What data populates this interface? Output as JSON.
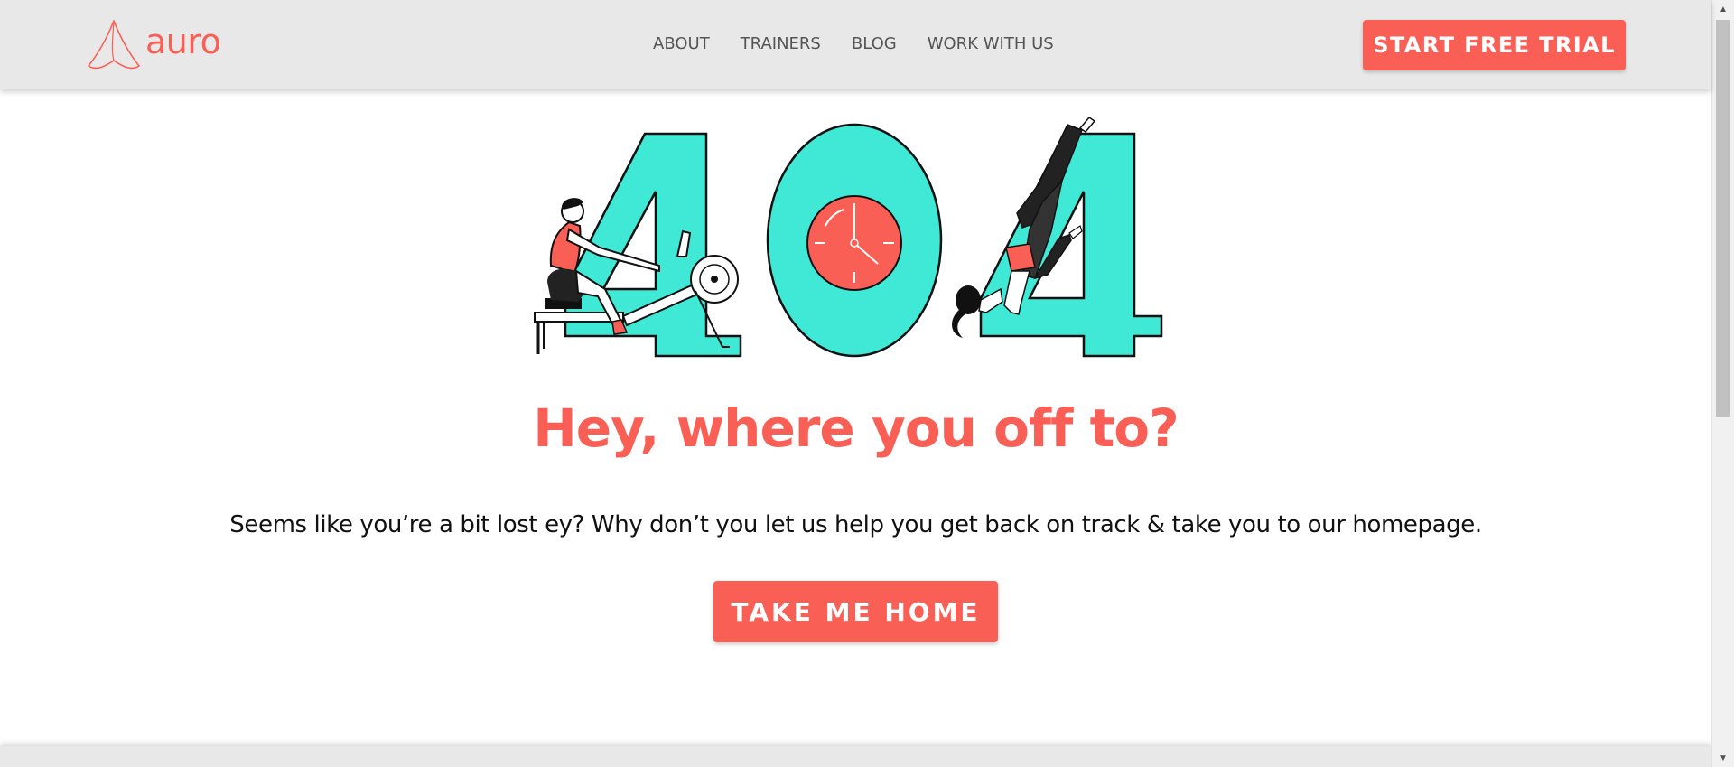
{
  "brand": {
    "name": "auro",
    "accent_color": "#fa5f55",
    "illustration_teal": "#40e8d6"
  },
  "nav": {
    "items": [
      {
        "label": "ABOUT"
      },
      {
        "label": "TRAINERS"
      },
      {
        "label": "BLOG"
      },
      {
        "label": "WORK WITH US"
      }
    ],
    "cta_label": "START FREE TRIAL"
  },
  "hero": {
    "illustration_text": "404",
    "headline": "Hey, where you off to?",
    "subtext": "Seems like you’re a bit lost ey? Why don’t you let us help you get back on track & take you to our homepage.",
    "button_label": "TAKE ME HOME"
  },
  "icons": {
    "logo": "auro-logo-icon",
    "scroll_up": "triangle-up-icon",
    "scroll_down": "triangle-down-icon"
  }
}
